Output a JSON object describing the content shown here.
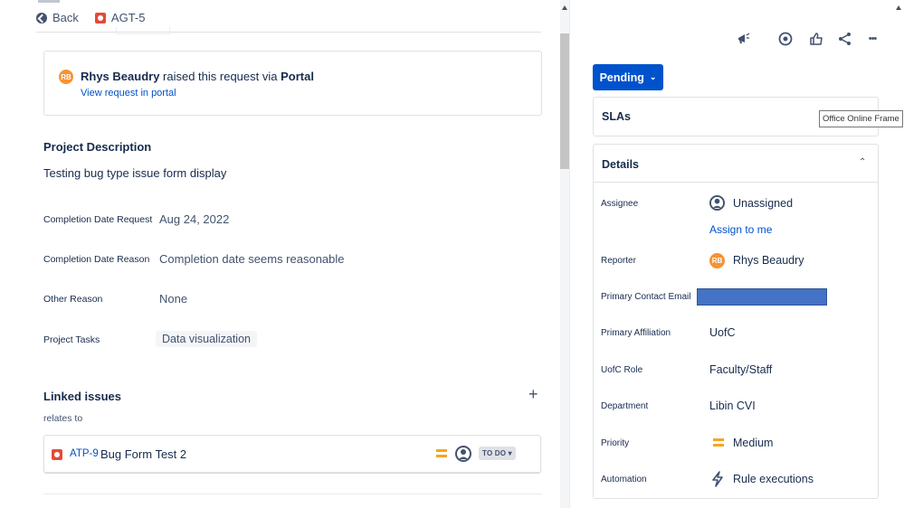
{
  "header": {
    "back_label": "Back",
    "issue_key": "AGT-5"
  },
  "raised": {
    "avatar_initials": "RB",
    "reporter_name": "Rhys Beaudry",
    "middle_text": " raised this request via ",
    "channel": "Portal",
    "view_link": "View request in portal"
  },
  "description": {
    "title": "Project Description",
    "text": "Testing bug type issue form display"
  },
  "fields": [
    {
      "label": "Completion Date Request",
      "value": "Aug 24, 2022"
    },
    {
      "label": "Completion Date Reason",
      "value": "Completion date seems reasonable"
    },
    {
      "label": "Other Reason",
      "value": "None"
    },
    {
      "label": "Project Tasks",
      "value": "Data visualization"
    }
  ],
  "linked": {
    "title": "Linked issues",
    "add_symbol": "+",
    "relation": "relates to",
    "issue": {
      "key": "ATP-9",
      "summary": "Bug Form Test 2",
      "status": "TO DO"
    }
  },
  "toolbar": {
    "icons": [
      "megaphone-icon",
      "eye-icon",
      "thumbs-up-icon",
      "share-icon",
      "more-icon"
    ],
    "more_label": "•••"
  },
  "status_button": {
    "label": "Pending",
    "color": "#0052cc"
  },
  "slas": {
    "title": "SLAs"
  },
  "tooltip": {
    "text": "Office Online Frame"
  },
  "details": {
    "title": "Details",
    "assignee_label": "Assignee",
    "assignee_value": "Unassigned",
    "assign_link": "Assign to me",
    "reporter_label": "Reporter",
    "reporter_initials": "RB",
    "reporter_value": "Rhys Beaudry",
    "email_label": "Primary Contact Email",
    "email_redaction_color": "#4472c4",
    "affiliation_label": "Primary Affiliation",
    "affiliation_value": "UofC",
    "role_label": "UofC Role",
    "role_value": "Faculty/Staff",
    "department_label": "Department",
    "department_value": "Libin CVI",
    "priority_label": "Priority",
    "priority_value": "Medium",
    "priority_color": "#f5a623",
    "automation_label": "Automation",
    "automation_value": "Rule executions"
  }
}
